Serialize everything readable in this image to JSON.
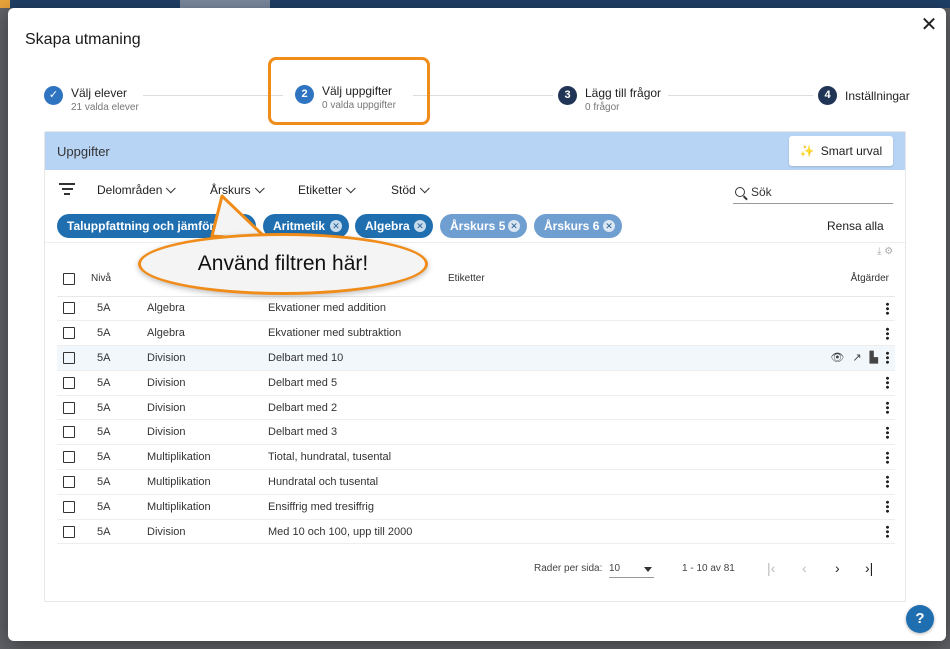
{
  "dialog": {
    "title": "Skapa utmaning",
    "close_icon": "close-icon"
  },
  "stepper": [
    {
      "number": "1",
      "label": "Välj elever",
      "sub": "21 valda elever",
      "state": "done"
    },
    {
      "number": "2",
      "label": "Välj uppgifter",
      "sub": "0 valda uppgifter",
      "state": "active"
    },
    {
      "number": "3",
      "label": "Lägg till frågor",
      "sub": "0 frågor",
      "state": "todo"
    },
    {
      "number": "4",
      "label": "Inställningar",
      "sub": "",
      "state": "todo"
    }
  ],
  "panel": {
    "title": "Uppgifter",
    "smart_label": "Smart urval"
  },
  "filters": {
    "items": [
      "Delområden",
      "Årskurs",
      "Etiketter",
      "Stöd"
    ],
    "search_placeholder": "Sök",
    "clear_all": "Rensa alla",
    "chips": [
      "Taluppfattning och jämförelse",
      "Aritmetik",
      "Algebra",
      "Årskurs 5",
      "Årskurs 6"
    ]
  },
  "table": {
    "headers": {
      "niva": "Nivå",
      "etiketter": "Etiketter",
      "atgarder": "Åtgärder"
    },
    "rows": [
      {
        "niva": "5A",
        "delomrade": "Algebra",
        "uppgift": "Ekvationer med addition"
      },
      {
        "niva": "5A",
        "delomrade": "Algebra",
        "uppgift": "Ekvationer med subtraktion"
      },
      {
        "niva": "5A",
        "delomrade": "Division",
        "uppgift": "Delbart med 10"
      },
      {
        "niva": "5A",
        "delomrade": "Division",
        "uppgift": "Delbart med 5"
      },
      {
        "niva": "5A",
        "delomrade": "Division",
        "uppgift": "Delbart med 2"
      },
      {
        "niva": "5A",
        "delomrade": "Division",
        "uppgift": "Delbart med 3"
      },
      {
        "niva": "5A",
        "delomrade": "Multiplikation",
        "uppgift": "Tiotal, hundratal, tusental"
      },
      {
        "niva": "5A",
        "delomrade": "Multiplikation",
        "uppgift": "Hundratal och tusental"
      },
      {
        "niva": "5A",
        "delomrade": "Multiplikation",
        "uppgift": "Ensiffrig med tresiffrig"
      },
      {
        "niva": "5A",
        "delomrade": "Division",
        "uppgift": "Med 10 och 100, upp till 2000"
      }
    ]
  },
  "pager": {
    "rows_per_page_label": "Rader per sida:",
    "rows_per_page": "10",
    "range": "1 - 10 av 81"
  },
  "callout": {
    "text": "Använd filtren här!"
  },
  "colors": {
    "accent": "#1f6fb0",
    "highlight": "#f08c1a",
    "panel_head": "#b8d4f5",
    "step_circle": "#203556"
  }
}
